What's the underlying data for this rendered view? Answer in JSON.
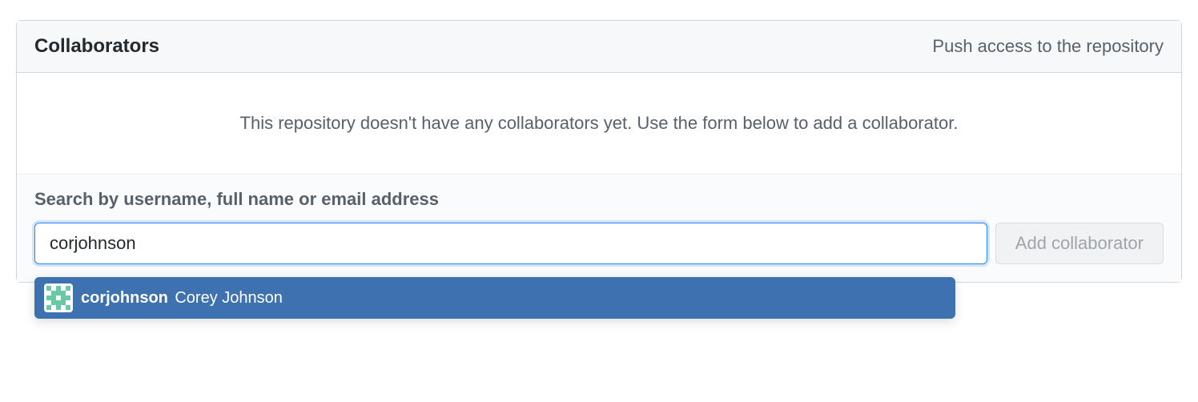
{
  "panel": {
    "title": "Collaborators",
    "subtitle": "Push access to the repository",
    "empty_message": "This repository doesn't have any collaborators yet. Use the form below to add a collaborator."
  },
  "search": {
    "label": "Search by username, full name or email address",
    "value": "corjohnson",
    "placeholder": ""
  },
  "add_button": {
    "label": "Add collaborator"
  },
  "autocomplete": {
    "items": [
      {
        "username": "corjohnson",
        "fullname": "Corey Johnson"
      }
    ]
  }
}
